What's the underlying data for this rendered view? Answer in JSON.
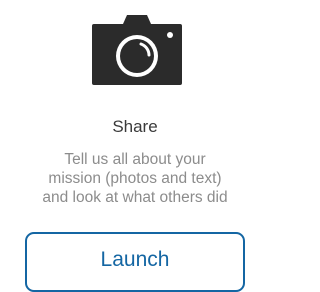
{
  "card": {
    "icon": "camera-icon",
    "title": "Share",
    "description_lines": [
      "Tell us all about your",
      "mission (photos and text)",
      "and look at what others did"
    ],
    "button_label": "Launch"
  },
  "colors": {
    "icon": "#2b2b2b",
    "title": "#3a3a3a",
    "description": "#8c8c8c",
    "button": "#1466a3"
  }
}
